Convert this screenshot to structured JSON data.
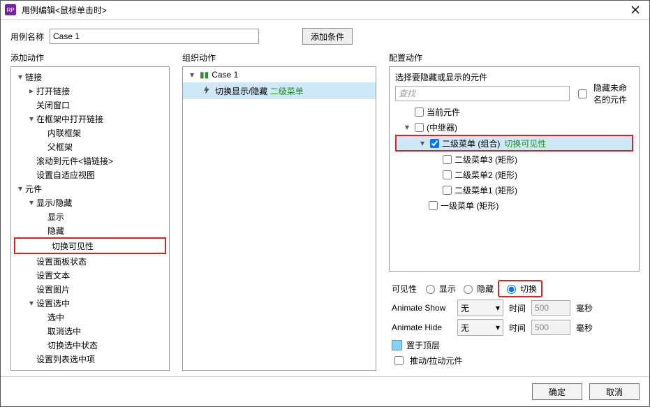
{
  "titlebar": {
    "title": "用例编辑<鼠标单击时>"
  },
  "name_row": {
    "label": "用例名称",
    "value": "Case 1",
    "add_condition": "添加条件"
  },
  "left": {
    "title": "添加动作",
    "groups": [
      {
        "label": "链接",
        "expanded": true,
        "children": [
          {
            "label": "打开链接",
            "expandable": true,
            "expanded": false
          },
          {
            "label": "关闭窗口"
          },
          {
            "label": "在框架中打开链接",
            "expanded": true,
            "children": [
              {
                "label": "内联框架"
              },
              {
                "label": "父框架"
              }
            ]
          },
          {
            "label": "滚动到元件<锚链接>"
          },
          {
            "label": "设置自适应视图"
          }
        ]
      },
      {
        "label": "元件",
        "expanded": true,
        "children": [
          {
            "label": "显示/隐藏",
            "expanded": true,
            "children": [
              {
                "label": "显示"
              },
              {
                "label": "隐藏"
              },
              {
                "label": "切换可见性",
                "highlight": true
              }
            ]
          },
          {
            "label": "设置面板状态"
          },
          {
            "label": "设置文本"
          },
          {
            "label": "设置图片"
          },
          {
            "label": "设置选中",
            "expanded": true,
            "children": [
              {
                "label": "选中"
              },
              {
                "label": "取消选中"
              },
              {
                "label": "切换选中状态"
              }
            ]
          },
          {
            "label": "设置列表选中项"
          }
        ]
      }
    ]
  },
  "mid": {
    "title": "组织动作",
    "case_label": "Case 1",
    "action_prefix": "切换显示/隐藏",
    "action_target": "二级菜单"
  },
  "right": {
    "title": "配置动作",
    "subtitle": "选择要隐藏或显示的元件",
    "search_placeholder": "查找",
    "hide_unnamed": "隐藏未命名的元件",
    "widgets": [
      {
        "indent": 0,
        "arrow": "none",
        "check": false,
        "label": "当前元件"
      },
      {
        "indent": 0,
        "arrow": "down",
        "check": false,
        "label": "(中继器)"
      },
      {
        "indent": 1,
        "arrow": "down",
        "check": true,
        "label": "二级菜单 (组合)",
        "suffix": "切换可见性",
        "selected": true,
        "highlight": true
      },
      {
        "indent": 2,
        "arrow": "none",
        "check": false,
        "label": "二级菜单3 (矩形)"
      },
      {
        "indent": 2,
        "arrow": "none",
        "check": false,
        "label": "二级菜单2 (矩形)"
      },
      {
        "indent": 2,
        "arrow": "none",
        "check": false,
        "label": "二级菜单1 (矩形)"
      },
      {
        "indent": 1,
        "arrow": "none",
        "check": false,
        "label": "一级菜单 (矩形)"
      }
    ],
    "visibility": {
      "label": "可见性",
      "show": "显示",
      "hide": "隐藏",
      "toggle": "切换",
      "selected": "toggle"
    },
    "anim_show": {
      "label": "Animate Show",
      "value": "无",
      "time_label": "时间",
      "time_value": "500",
      "unit": "毫秒"
    },
    "anim_hide": {
      "label": "Animate Hide",
      "value": "无",
      "time_label": "时间",
      "time_value": "500",
      "unit": "毫秒"
    },
    "bring_front": "置于顶层",
    "push_pull": "推动/拉动元件"
  },
  "footer": {
    "ok": "确定",
    "cancel": "取消"
  }
}
